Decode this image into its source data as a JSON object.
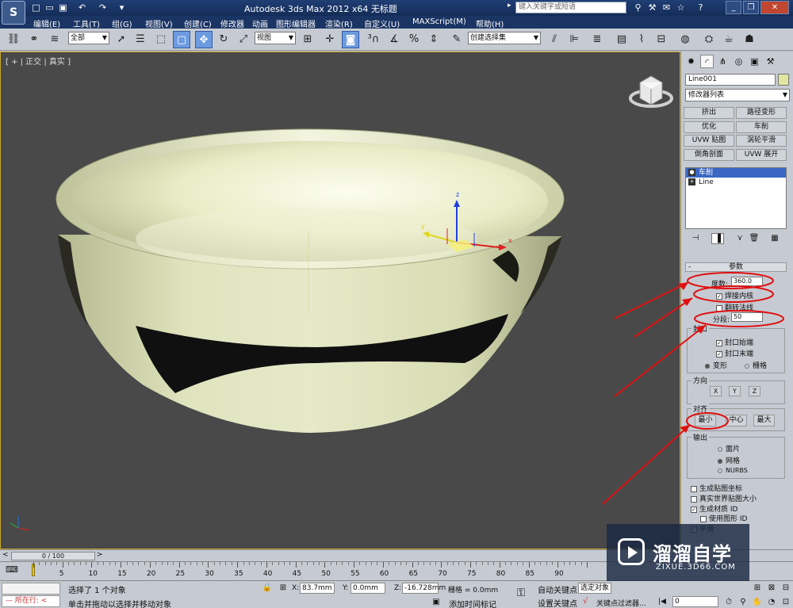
{
  "titlebar": {
    "app_logo": "S",
    "title": "Autodesk 3ds Max  2012 x64     无标题",
    "search_placeholder": "键入关键字或短语",
    "quick_access": [
      "new-icon",
      "open-icon",
      "save-icon",
      "undo-icon",
      "redo-icon"
    ],
    "window_controls": {
      "minimize": "_",
      "restore": "❐",
      "close": "✕"
    }
  },
  "menu": [
    "编辑(E)",
    "工具(T)",
    "组(G)",
    "视图(V)",
    "创建(C)",
    "修改器",
    "动画",
    "图形编辑器",
    "渲染(R)",
    "自定义(U)",
    "MAXScript(M)",
    "帮助(H)"
  ],
  "toolbar": {
    "selection_filter": "全部",
    "reference_coord": "视图",
    "named_selection": "创建选择集"
  },
  "viewport": {
    "label": "[ + | 正交 | 真实 ]",
    "gizmo": {
      "x": "x",
      "y": "y",
      "z": "z"
    }
  },
  "command_panel": {
    "object_name": "Line001",
    "object_color": "#dfe79f",
    "modifier_list": "修改器列表",
    "modifier_buttons": [
      "挤出",
      "路径变形",
      "优化",
      "车削",
      "UVW 贴图",
      "涡轮平滑",
      "倒角剖面",
      "UVW 展开"
    ],
    "stack": [
      {
        "label": "车削",
        "selected": true
      },
      {
        "label": "Line",
        "selected": false
      }
    ],
    "rollout_title": "参数",
    "degrees_label": "度数:",
    "degrees_value": "360.0",
    "weld_core": "焊接内核",
    "weld_core_checked": true,
    "flip_normals": "翻转法线",
    "flip_normals_checked": false,
    "segments_label": "分段:",
    "segments_value": "50",
    "capping": {
      "title": "封口",
      "cap_start": "封口始端",
      "cap_end": "封口末端",
      "morph": "变形",
      "grid": "栅格",
      "selected": "变形"
    },
    "direction": {
      "title": "方向",
      "axes": [
        "X",
        "Y",
        "Z"
      ]
    },
    "align": {
      "title": "对齐",
      "buttons": [
        "最小",
        "中心",
        "最大"
      ]
    },
    "output": {
      "title": "输出",
      "options": [
        "面片",
        "网格",
        "NURBS"
      ],
      "selected": "网格"
    },
    "checkboxes": [
      {
        "label": "生成贴图坐标",
        "checked": false
      },
      {
        "label": "真实世界贴图大小",
        "checked": false
      },
      {
        "label": "生成材质 ID",
        "checked": true
      },
      {
        "label": "使用图形 ID",
        "checked": false
      },
      {
        "label": "平滑",
        "checked": true
      }
    ]
  },
  "timeline": {
    "slider": "0 / 100",
    "ticks": [
      "5",
      "10",
      "15",
      "20",
      "25",
      "30",
      "35",
      "40",
      "45",
      "50",
      "55",
      "60",
      "65",
      "70",
      "75",
      "80",
      "85",
      "90"
    ]
  },
  "status": {
    "running": "所在行:",
    "selection": "选择了 1 个对象",
    "prompt": "单击并拖动以选择并移动对象",
    "x_label": "X:",
    "x_value": "83.7mm",
    "y_label": "Y:",
    "y_value": "0.0mm",
    "z_label": "Z:",
    "z_value": "-16.728mm",
    "grid": "栅格 = 0.0mm",
    "auto_key": "自动关键点",
    "set_key": "设置关键点",
    "selected_object": "选定对象",
    "key_filters": "关键点过滤器...",
    "add_time_tag": "添加时间标记",
    "frame": "0"
  },
  "watermark": {
    "title": "溜溜自学",
    "url": "ZIXUE.3D66.COM"
  },
  "colors": {
    "viewport_bg": "#494949",
    "object": "#dfe3b4",
    "annotation": "#e01010",
    "titlebar": "#1f3e74"
  }
}
